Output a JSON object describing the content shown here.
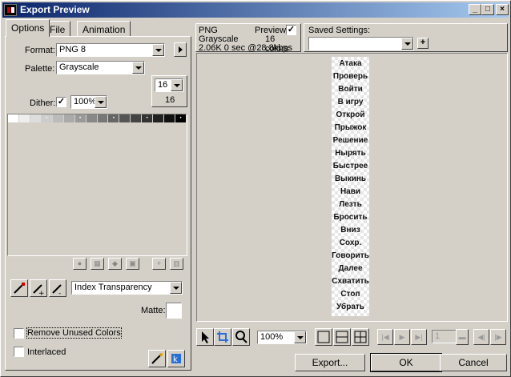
{
  "window": {
    "title": "Export Preview",
    "controls": {
      "minimize": "_",
      "maximize": "□",
      "close": "×"
    }
  },
  "tabs": [
    {
      "label": "Options",
      "active": true
    },
    {
      "label": "File",
      "active": false
    },
    {
      "label": "Animation",
      "active": false
    }
  ],
  "options": {
    "format_label": "Format:",
    "format_value": "PNG 8",
    "palette_label": "Palette:",
    "palette_value": "Grayscale",
    "colors_value": "16",
    "colors_count": "16",
    "dither_label": "Dither:",
    "dither_checked": true,
    "dither_value": "100%",
    "transparency_value": "Index Transparency",
    "matte_label": "Matte:",
    "remove_unused_label": "Remove Unused Colors",
    "interlaced_label": "Interlaced"
  },
  "palette_swatches": [
    "#ffffff",
    "#eeeeee",
    "#dddddd",
    "#cccccc",
    "#bbbbbb",
    "#aaaaaa",
    "#999999",
    "#888888",
    "#777777",
    "#666666",
    "#555555",
    "#444444",
    "#333333",
    "#222222",
    "#111111",
    "#000000"
  ],
  "info": {
    "format": "PNG",
    "preview_label": "Preview",
    "preview_checked": true,
    "palette": "Grayscale",
    "colors": "16 colors",
    "size_time": "2.06K  0 sec @28.8kbps",
    "saved_settings_label": "Saved Settings:",
    "saved_settings_value": "",
    "add_label": "+"
  },
  "preview_words": [
    "Атака",
    "Проверь",
    "Войти",
    "В игру",
    "Открой",
    "Прыжок",
    "Решение",
    "Нырять",
    "Быстрее",
    "Выкинь",
    "Нави",
    "Лезть",
    "Бросить",
    "Вниз",
    "Сохр.",
    "Говорить",
    "Далее",
    "Схватить",
    "Стоп",
    "Убрать"
  ],
  "toolbar": {
    "zoom_value": "100%",
    "frame_value": "1"
  },
  "buttons": {
    "export": "Export...",
    "ok": "OK",
    "cancel": "Cancel"
  }
}
